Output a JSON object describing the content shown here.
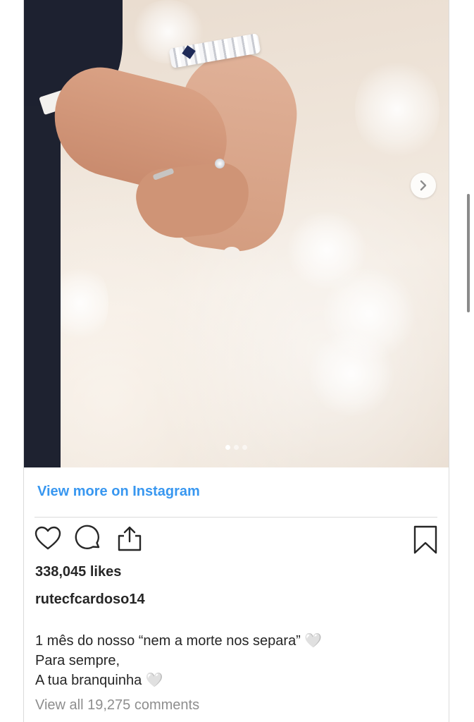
{
  "post": {
    "carousel": {
      "count": 3,
      "active_index": 0,
      "next_icon": "chevron-right-icon"
    },
    "view_more_label": "View more on Instagram",
    "actions": {
      "like_icon": "heart-icon",
      "comment_icon": "comment-icon",
      "share_icon": "share-icon",
      "save_icon": "bookmark-icon"
    },
    "likes_text": "338,045 likes",
    "username": "rutecfcardoso14",
    "caption_lines": [
      "1 mês do nosso “nem a morte nos separa” 🤍",
      "Para sempre,",
      "A tua branquinha 🤍"
    ],
    "comments_link": "View all 19,275 comments"
  },
  "colors": {
    "link_blue": "#3897f0",
    "text_primary": "#262626",
    "text_secondary": "#8e8e8e",
    "border": "#dbdbdb"
  }
}
